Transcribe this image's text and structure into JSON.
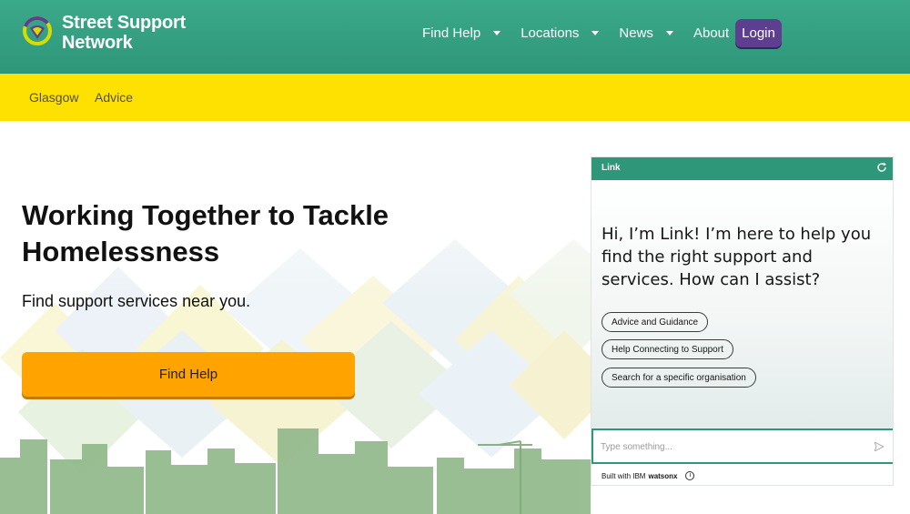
{
  "brand": {
    "line1": "Street Support",
    "line2": "Network"
  },
  "nav": {
    "items": [
      {
        "label": "Find Help"
      },
      {
        "label": "Locations"
      },
      {
        "label": "News"
      },
      {
        "label": "About"
      }
    ],
    "login_label": "Login"
  },
  "subnav": {
    "items": [
      {
        "label": "Glasgow"
      },
      {
        "label": "Advice"
      }
    ]
  },
  "hero": {
    "title": "Working Together to Tackle Homelessness",
    "subtitle": "Find support services near you.",
    "cta_label": "Find Help"
  },
  "chat": {
    "title": "Link",
    "message": "Hi, I’m Link! I’m here to help you find the right support and services. How can I assist?",
    "chips": [
      {
        "label": "Advice and Guidance"
      },
      {
        "label": "Help Connecting to Support"
      },
      {
        "label": "Search for a specific organisation"
      }
    ],
    "input_placeholder": "Type something...",
    "footer_prefix": "Built with IBM",
    "footer_brand": "watsonx",
    "info_glyph": "i"
  },
  "colors": {
    "header_green": "#2f9779",
    "subnav_yellow": "#ffe100",
    "login_purple": "#5e3f8f",
    "cta_orange": "#ffa300"
  },
  "icons": [
    "logo-icon",
    "chevron-down-icon",
    "refresh-icon",
    "send-icon",
    "info-icon",
    "crane-icon"
  ]
}
